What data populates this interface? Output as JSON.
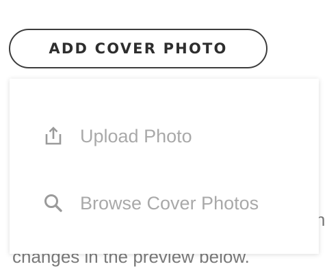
{
  "add_cover_button": {
    "label": "ADD COVER PHOTO"
  },
  "background_text": {
    "right_fragment": "n",
    "bottom_fragment": "changes in the preview below."
  },
  "dropdown": {
    "items": [
      {
        "label": "Upload Photo",
        "icon": "upload-icon"
      },
      {
        "label": "Browse Cover Photos",
        "icon": "search-icon"
      }
    ]
  },
  "colors": {
    "button_border": "#3c3c3c",
    "button_text": "#2e2e2e",
    "menu_text": "#a9a9a9",
    "menu_icon": "#9a9a9a",
    "background_text": "#7a7a7a"
  }
}
